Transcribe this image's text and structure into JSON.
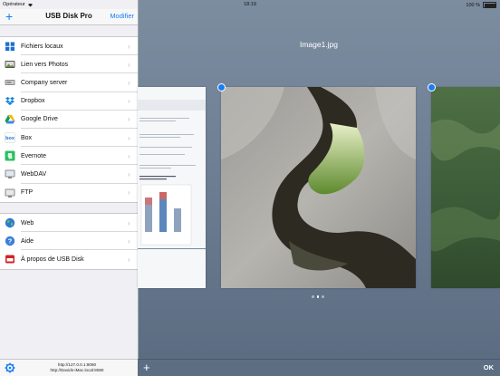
{
  "status_bar": {
    "carrier": "Opérateur",
    "time": "18:19",
    "battery": "100 %"
  },
  "sidebar": {
    "title": "USB Disk Pro",
    "edit_label": "Modifier",
    "groups": [
      [
        {
          "label": "Fichiers locaux",
          "icon": "local-files-icon"
        },
        {
          "label": "Lien vers Photos",
          "icon": "photos-link-icon"
        },
        {
          "label": "Company server",
          "icon": "server-icon"
        },
        {
          "label": "Dropbox",
          "icon": "dropbox-icon"
        },
        {
          "label": "Google Drive",
          "icon": "google-drive-icon"
        },
        {
          "label": "Box",
          "icon": "box-icon"
        },
        {
          "label": "Evernote",
          "icon": "evernote-icon"
        },
        {
          "label": "WebDAV",
          "icon": "webdav-icon"
        },
        {
          "label": "FTP",
          "icon": "ftp-icon"
        }
      ],
      [
        {
          "label": "Web",
          "icon": "web-globe-icon"
        },
        {
          "label": "Aide",
          "icon": "help-icon"
        },
        {
          "label": "À propos de USB Disk",
          "icon": "about-icon"
        }
      ]
    ],
    "footer": {
      "url_ip": "http://127.0.0.1:8080",
      "url_host": "http://Davids-iMac.local:8080"
    }
  },
  "viewer": {
    "title": "Image1.jpg",
    "ok_label": "OK",
    "page_count": 3,
    "current_page": 2
  },
  "colors": {
    "accent": "#1a7cf5"
  }
}
